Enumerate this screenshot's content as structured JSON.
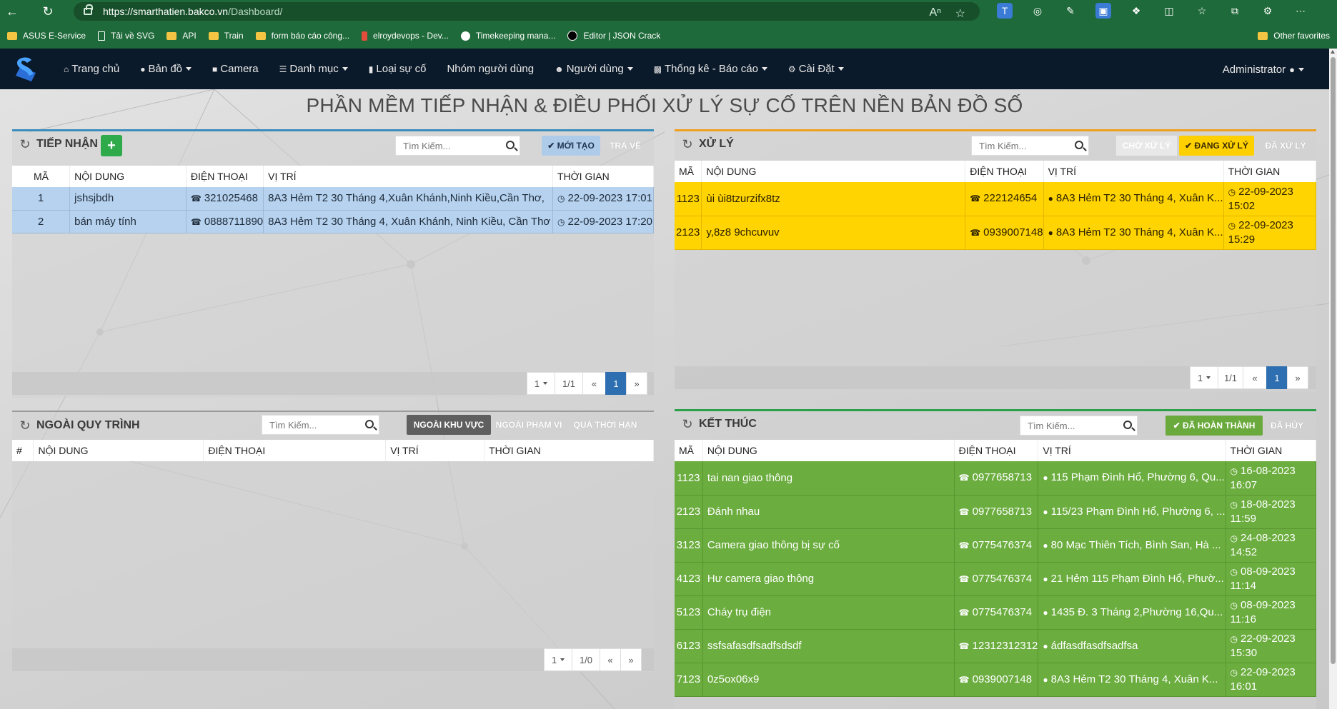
{
  "browser": {
    "url_host": "https://smarthatien.bakco.vn",
    "url_path": "/Dashboard/",
    "bookmarks": [
      "ASUS E-Service",
      "Tải về SVG",
      "API",
      "Train",
      "form báo cáo công...",
      "elroydevops - Dev...",
      "Timekeeping mana...",
      "Editor | JSON Crack"
    ],
    "other_favorites": "Other favorites"
  },
  "nav": {
    "items": [
      {
        "label": "Trang chủ",
        "icon": "home-icon"
      },
      {
        "label": "Bản đồ",
        "icon": "map-marker-icon",
        "dropdown": true
      },
      {
        "label": "Camera",
        "icon": "camera-icon"
      },
      {
        "label": "Danh mục",
        "icon": "list-icon",
        "dropdown": true
      },
      {
        "label": "Loại sự cố",
        "icon": "book-icon"
      },
      {
        "label": "Nhóm người dùng",
        "icon": ""
      },
      {
        "label": "Người dùng",
        "icon": "users-icon",
        "dropdown": true
      },
      {
        "label": "Thống kê - Báo cáo",
        "icon": "bar-chart-icon",
        "dropdown": true
      },
      {
        "label": "Cài Đặt",
        "icon": "gear-icon",
        "dropdown": true
      }
    ],
    "admin": "Administrator"
  },
  "page_title": "PHẦN MỀM TIẾP NHẬN & ĐIỀU PHỐI XỬ LÝ SỰ CỐ TRÊN NỀN BẢN ĐỒ SỐ",
  "search_placeholder": "Tìm Kiếm...",
  "tiep_nhan": {
    "title": "TIẾP NHẬN",
    "tabs": [
      "MỚI TẠO",
      "TRẢ VỀ"
    ],
    "columns": [
      "MÃ",
      "NỘI DUNG",
      "ĐIỆN THOẠI",
      "VỊ TRÍ",
      "THỜI GIAN"
    ],
    "rows": [
      [
        "1",
        "jshsjbdh",
        "321025468",
        "8A3 Hẻm T2 30 Tháng 4,Xuân Khánh,Ninh Kiều,Cần Thơ,",
        "22-09-2023 17:01"
      ],
      [
        "2",
        "bán máy tính",
        "0888711890",
        "8A3 Hẻm T2 30 Tháng 4, Xuân Khánh, Ninh Kiều, Cần Thơ",
        "22-09-2023 17:20"
      ]
    ],
    "pager": {
      "size": "1",
      "pages": "1/1",
      "current": "1"
    }
  },
  "xu_ly": {
    "title": "XỬ LÝ",
    "tabs": [
      "CHỜ XỬ LÝ",
      "ĐANG XỬ LÝ",
      "ĐÃ XỬ LÝ"
    ],
    "columns": [
      "MÃ",
      "NỘI DUNG",
      "ĐIỆN THOẠI",
      "VỊ TRÍ",
      "THỜI GIAN"
    ],
    "rows": [
      [
        "1123",
        "ùi ùi8tzurzifx8tz",
        "222124654",
        "8A3 Hẻm T2 30 Tháng 4, Xuân K...",
        "22-09-2023",
        "15:02"
      ],
      [
        "2123",
        "y,8z8 9chcuvuv",
        "0939007148",
        "8A3 Hẻm T2 30 Tháng 4, Xuân K...",
        "22-09-2023",
        "15:29"
      ]
    ],
    "pager": {
      "size": "1",
      "pages": "1/1",
      "current": "1"
    }
  },
  "ngoai_quy_trinh": {
    "title": "NGOÀI QUY TRÌNH",
    "tabs": [
      "NGOÀI KHU VỰC",
      "NGOÀI PHẠM VI",
      "QUÁ THỜI HẠN"
    ],
    "columns": [
      "#",
      "NỘI DUNG",
      "ĐIỆN THOẠI",
      "VỊ TRÍ",
      "THỜI GIAN"
    ],
    "pager": {
      "size": "1",
      "pages": "1/0"
    }
  },
  "ket_thuc": {
    "title": "KẾT THÚC",
    "tabs": [
      "ĐÃ HOÀN THÀNH",
      "ĐÃ HỦY"
    ],
    "columns": [
      "MÃ",
      "NỘI DUNG",
      "ĐIỆN THOẠI",
      "VỊ TRÍ",
      "THỜI GIAN"
    ],
    "rows": [
      [
        "1123",
        "tai nan giao thông",
        "0977658713",
        "115 Phạm Đình Hổ, Phường 6, Qu...",
        "16-08-2023",
        "16:07"
      ],
      [
        "2123",
        "Đánh nhau",
        "0977658713",
        "115/23 Phạm Đình Hổ, Phường 6, ...",
        "18-08-2023",
        "11:59"
      ],
      [
        "3123",
        "Camera giao thông bị sự cố",
        "0775476374",
        "80 Mạc Thiên Tích, Bình San, Hà ...",
        "24-08-2023",
        "14:52"
      ],
      [
        "4123",
        "Hư camera giao thông",
        "0775476374",
        "21 Hẻm 115 Phạm Đình Hổ, Phườ...",
        "08-09-2023",
        "11:14"
      ],
      [
        "5123",
        "Cháy trụ điện",
        "0775476374",
        "1435 Đ. 3 Tháng 2,Phường 16,Qu...",
        "08-09-2023",
        "11:16"
      ],
      [
        "6123",
        "ssfsafasdfsadfsdsdf",
        "12312312312",
        "ádfasdfasdfsadfsa",
        "22-09-2023",
        "15:30"
      ],
      [
        "7123",
        "0z5ox06x9",
        "0939007148",
        "8A3 Hẻm T2 30 Tháng 4, Xuân K...",
        "22-09-2023",
        "16:01"
      ]
    ]
  }
}
